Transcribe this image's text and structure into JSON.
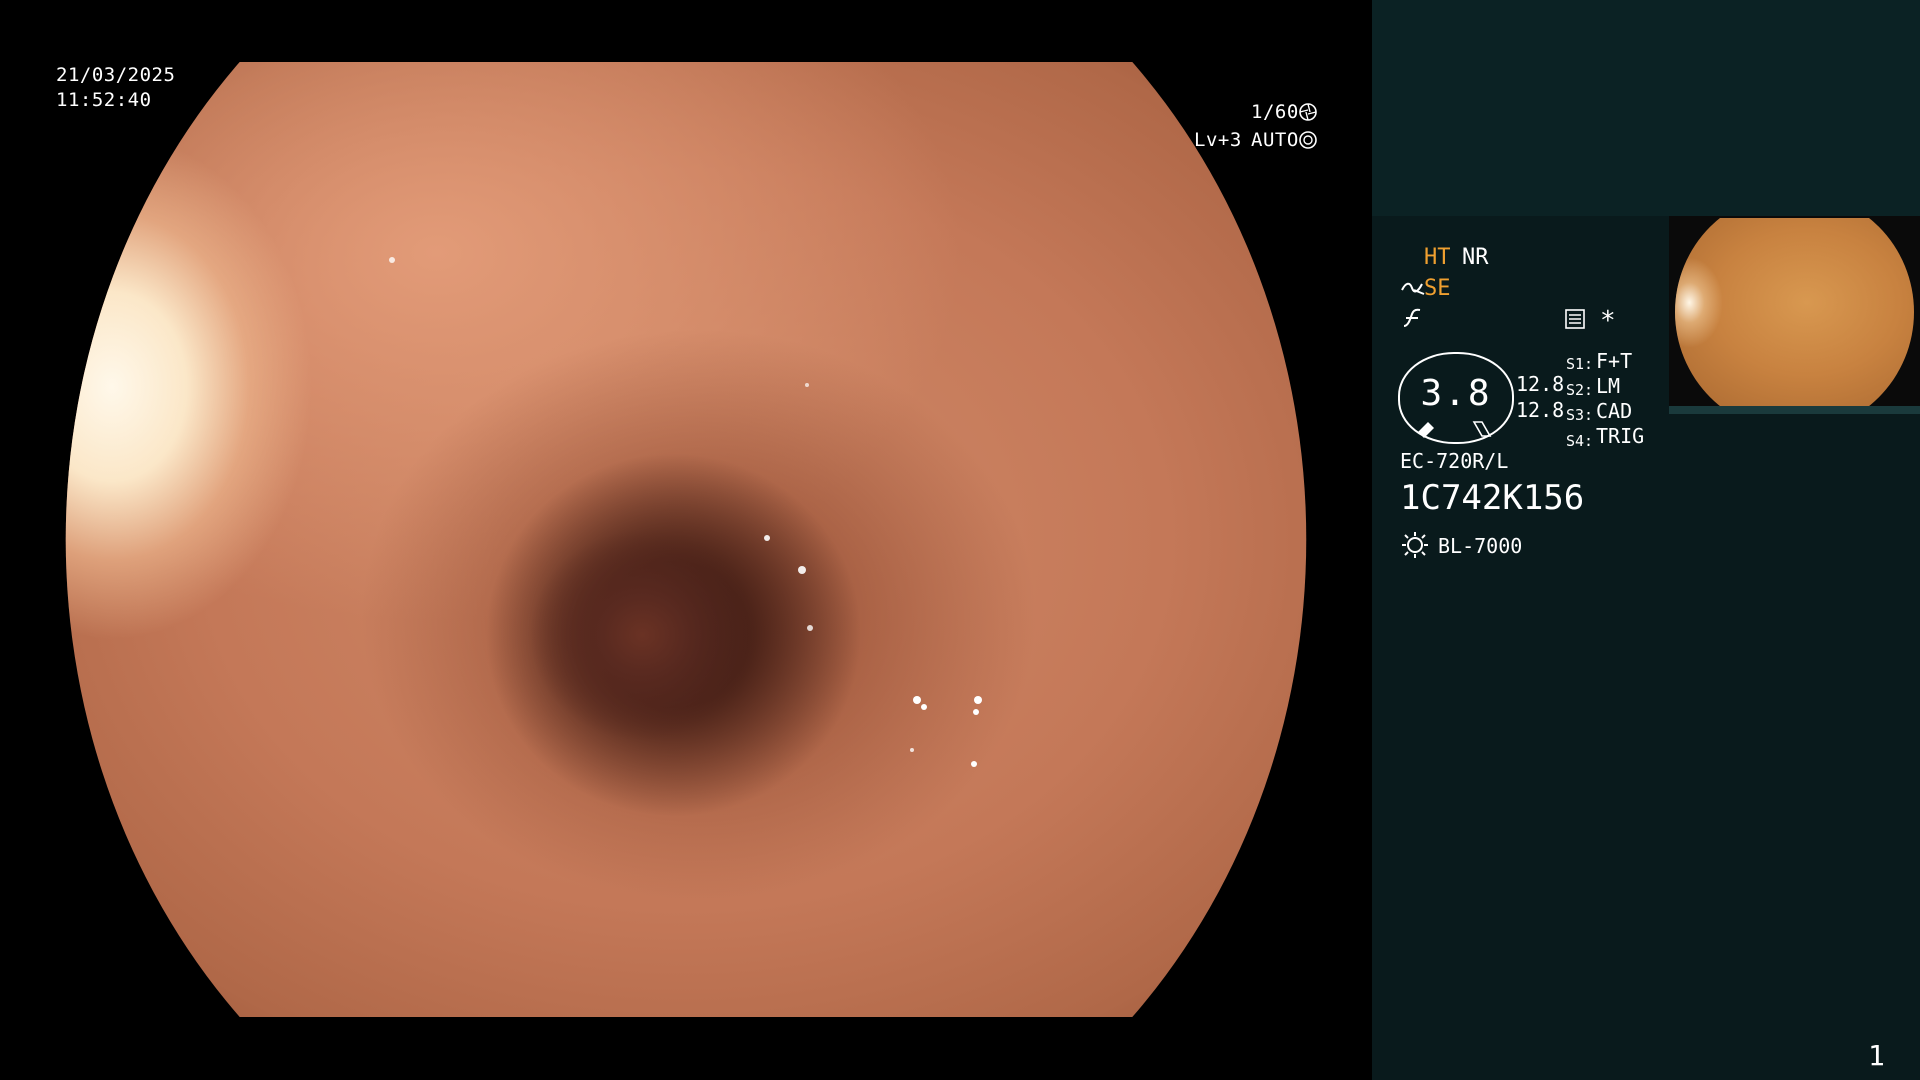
{
  "osd": {
    "date": "21/03/2025",
    "time": "11:52:40",
    "shutter": "1/60",
    "shutter_icon": "aperture-icon",
    "level": "Lv+3",
    "mode": "AUTO",
    "mode_icon": "iris-icon"
  },
  "sidebar": {
    "ht": "HT",
    "nr": "NR",
    "se": "SE",
    "se_icon": "tilde-arrow-icon",
    "f_icon": "function-icon",
    "memo_icon": "memo-icon",
    "asterisk": "*",
    "gauge_value": "3.8",
    "val_a": "12.8",
    "val_b": "12.8",
    "switches": [
      {
        "key": "S1:",
        "value": "F+T"
      },
      {
        "key": "S2:",
        "value": "LM"
      },
      {
        "key": "S3:",
        "value": "CAD"
      },
      {
        "key": "S4:",
        "value": "TRIG"
      }
    ],
    "scope_model": "EC-720R/L",
    "serial": "1C742K156",
    "light_icon": "light-source-icon",
    "light_source": "BL-7000",
    "page_number": "1"
  },
  "colors": {
    "accent_yellow": "#f0a030",
    "sidebar_bg": "#091a1c",
    "sidebar_top_bg": "#0b2224"
  }
}
